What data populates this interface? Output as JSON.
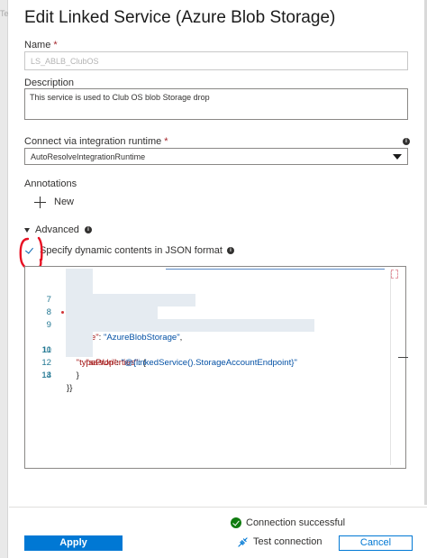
{
  "background_tab_label": "Te",
  "title": "Edit Linked Service (Azure Blob Storage)",
  "name": {
    "label": "Name",
    "required_mark": "*",
    "value": "LS_ABLB_ClubOS"
  },
  "description": {
    "label": "Description",
    "value": "This service is used to Club OS blob Storage drop"
  },
  "runtime": {
    "label": "Connect via integration runtime",
    "required_mark": "*",
    "selected": "AutoResolveIntegrationRuntime"
  },
  "annotations": {
    "label": "Annotations",
    "new_label": "New"
  },
  "advanced": {
    "label": "Advanced"
  },
  "dynamic_json": {
    "checked": true,
    "label": "Specify dynamic contents in JSON format"
  },
  "code_lines": [
    {
      "num": "7",
      "text": "        }"
    },
    {
      "num": "8",
      "text": "    },"
    },
    {
      "num": "9",
      "text": "    \"type\": \"AzureBlobStorage\","
    },
    {
      "num": "10",
      "text": "    \"typeProperties\": {"
    },
    {
      "num": "11",
      "text": "        \"sasUri\": \"@{linkedService().StorageAccountEndpoint}\""
    },
    {
      "num": "12",
      "text": "    }"
    },
    {
      "num": "13",
      "text": ""
    },
    {
      "num": "14",
      "text": "}}"
    }
  ],
  "status": {
    "text": "Connection successful",
    "color": "#107c10"
  },
  "buttons": {
    "apply": "Apply",
    "test_connection": "Test connection",
    "cancel": "Cancel"
  },
  "colors": {
    "accent": "#0078d4",
    "required": "#a4262c",
    "json_key": "#a31515",
    "json_string": "#0451a5"
  }
}
